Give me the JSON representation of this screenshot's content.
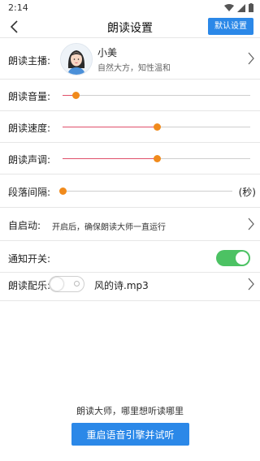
{
  "status": {
    "time": "2:14"
  },
  "nav": {
    "title": "朗读设置",
    "default_button": "默认设置"
  },
  "anchor": {
    "label": "朗读主播:",
    "name": "小美",
    "description": "自然大方，知性温和"
  },
  "volume": {
    "label": "朗读音量:",
    "value": 0.07
  },
  "speed": {
    "label": "朗读速度:",
    "value": 0.5
  },
  "pitch": {
    "label": "朗读声调:",
    "value": 0.5
  },
  "paragraph": {
    "label": "段落间隔:",
    "value": 0.0,
    "unit": "(秒)"
  },
  "autostart": {
    "label": "自启动:",
    "text": "开启后，确保朗读大师一直运行"
  },
  "notify": {
    "label": "通知开关:",
    "on": true
  },
  "music": {
    "label": "朗读配乐:",
    "file": "风的诗.mp3",
    "on": false
  },
  "footer": {
    "text": "朗读大师，哪里想听读哪里",
    "button": "重启语音引擎并试听"
  },
  "colors": {
    "accent": "#2b88e8",
    "thumb": "#f08a1c",
    "fill": "#e0506a",
    "toggle_on": "#4cc263"
  }
}
